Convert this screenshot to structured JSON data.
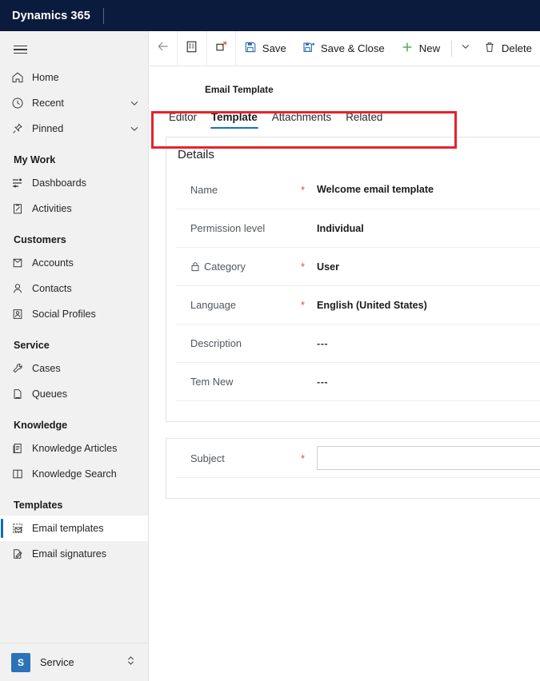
{
  "header": {
    "brand": "Dynamics 365"
  },
  "sidebar": {
    "menu_icon": "hamburger-icon",
    "items": [
      {
        "label": "Home",
        "icon": "home-icon",
        "type": "item"
      },
      {
        "label": "Recent",
        "icon": "clock-icon",
        "type": "item",
        "chevron": true
      },
      {
        "label": "Pinned",
        "icon": "pin-icon",
        "type": "item",
        "chevron": true
      },
      {
        "label": "My Work",
        "type": "group"
      },
      {
        "label": "Dashboards",
        "icon": "dashboard-icon",
        "type": "item"
      },
      {
        "label": "Activities",
        "icon": "clipboard-icon",
        "type": "item"
      },
      {
        "label": "Customers",
        "type": "group"
      },
      {
        "label": "Accounts",
        "icon": "account-icon",
        "type": "item"
      },
      {
        "label": "Contacts",
        "icon": "person-icon",
        "type": "item"
      },
      {
        "label": "Social Profiles",
        "icon": "social-profile-icon",
        "type": "item"
      },
      {
        "label": "Service",
        "type": "group"
      },
      {
        "label": "Cases",
        "icon": "wrench-icon",
        "type": "item"
      },
      {
        "label": "Queues",
        "icon": "queue-icon",
        "type": "item"
      },
      {
        "label": "Knowledge",
        "type": "group"
      },
      {
        "label": "Knowledge Articles",
        "icon": "article-icon",
        "type": "item"
      },
      {
        "label": "Knowledge Search",
        "icon": "book-icon",
        "type": "item"
      },
      {
        "label": "Templates",
        "type": "group"
      },
      {
        "label": "Email templates",
        "icon": "email-template-icon",
        "type": "item",
        "active": true
      },
      {
        "label": "Email signatures",
        "icon": "signature-icon",
        "type": "item"
      }
    ],
    "footer": {
      "tile": "S",
      "app": "Service",
      "chevron": "up-down-chevron-icon"
    }
  },
  "commandbar": {
    "back": "back-arrow-icon",
    "form_selector": "form-icon",
    "popout": "popout-icon",
    "save_label": "Save",
    "save_close_label": "Save & Close",
    "new_label": "New",
    "overflow": "chevron-down-icon",
    "delete_label": "Delete"
  },
  "form": {
    "entity_label": "Email Template",
    "tabs": [
      {
        "label": "Editor",
        "active": false
      },
      {
        "label": "Template",
        "active": true
      },
      {
        "label": "Attachments",
        "active": false
      },
      {
        "label": "Related",
        "active": false
      }
    ],
    "details_title": "Details",
    "fields": [
      {
        "label": "Name",
        "required": true,
        "value": "Welcome email template",
        "locked": false
      },
      {
        "label": "Permission level",
        "required": false,
        "value": "Individual",
        "locked": false
      },
      {
        "label": "Category",
        "required": true,
        "value": "User",
        "locked": true
      },
      {
        "label": "Language",
        "required": true,
        "value": "English (United States)",
        "locked": false
      },
      {
        "label": "Description",
        "required": false,
        "value": "---",
        "locked": false
      },
      {
        "label": "Tem New",
        "required": false,
        "value": "---",
        "locked": false
      }
    ],
    "subject": {
      "label": "Subject",
      "required": true,
      "value": ""
    }
  },
  "annotation": {
    "shape": "rectangle",
    "color": "#e8232a",
    "target": "tab-strip"
  },
  "colors": {
    "header_bg": "#0b1b3d",
    "sidebar_bg": "#f1f1f1",
    "accent": "#0f6cbd",
    "required": "#e04a3f",
    "annotation": "#e8232a",
    "app_tile": "#2b72b8"
  }
}
